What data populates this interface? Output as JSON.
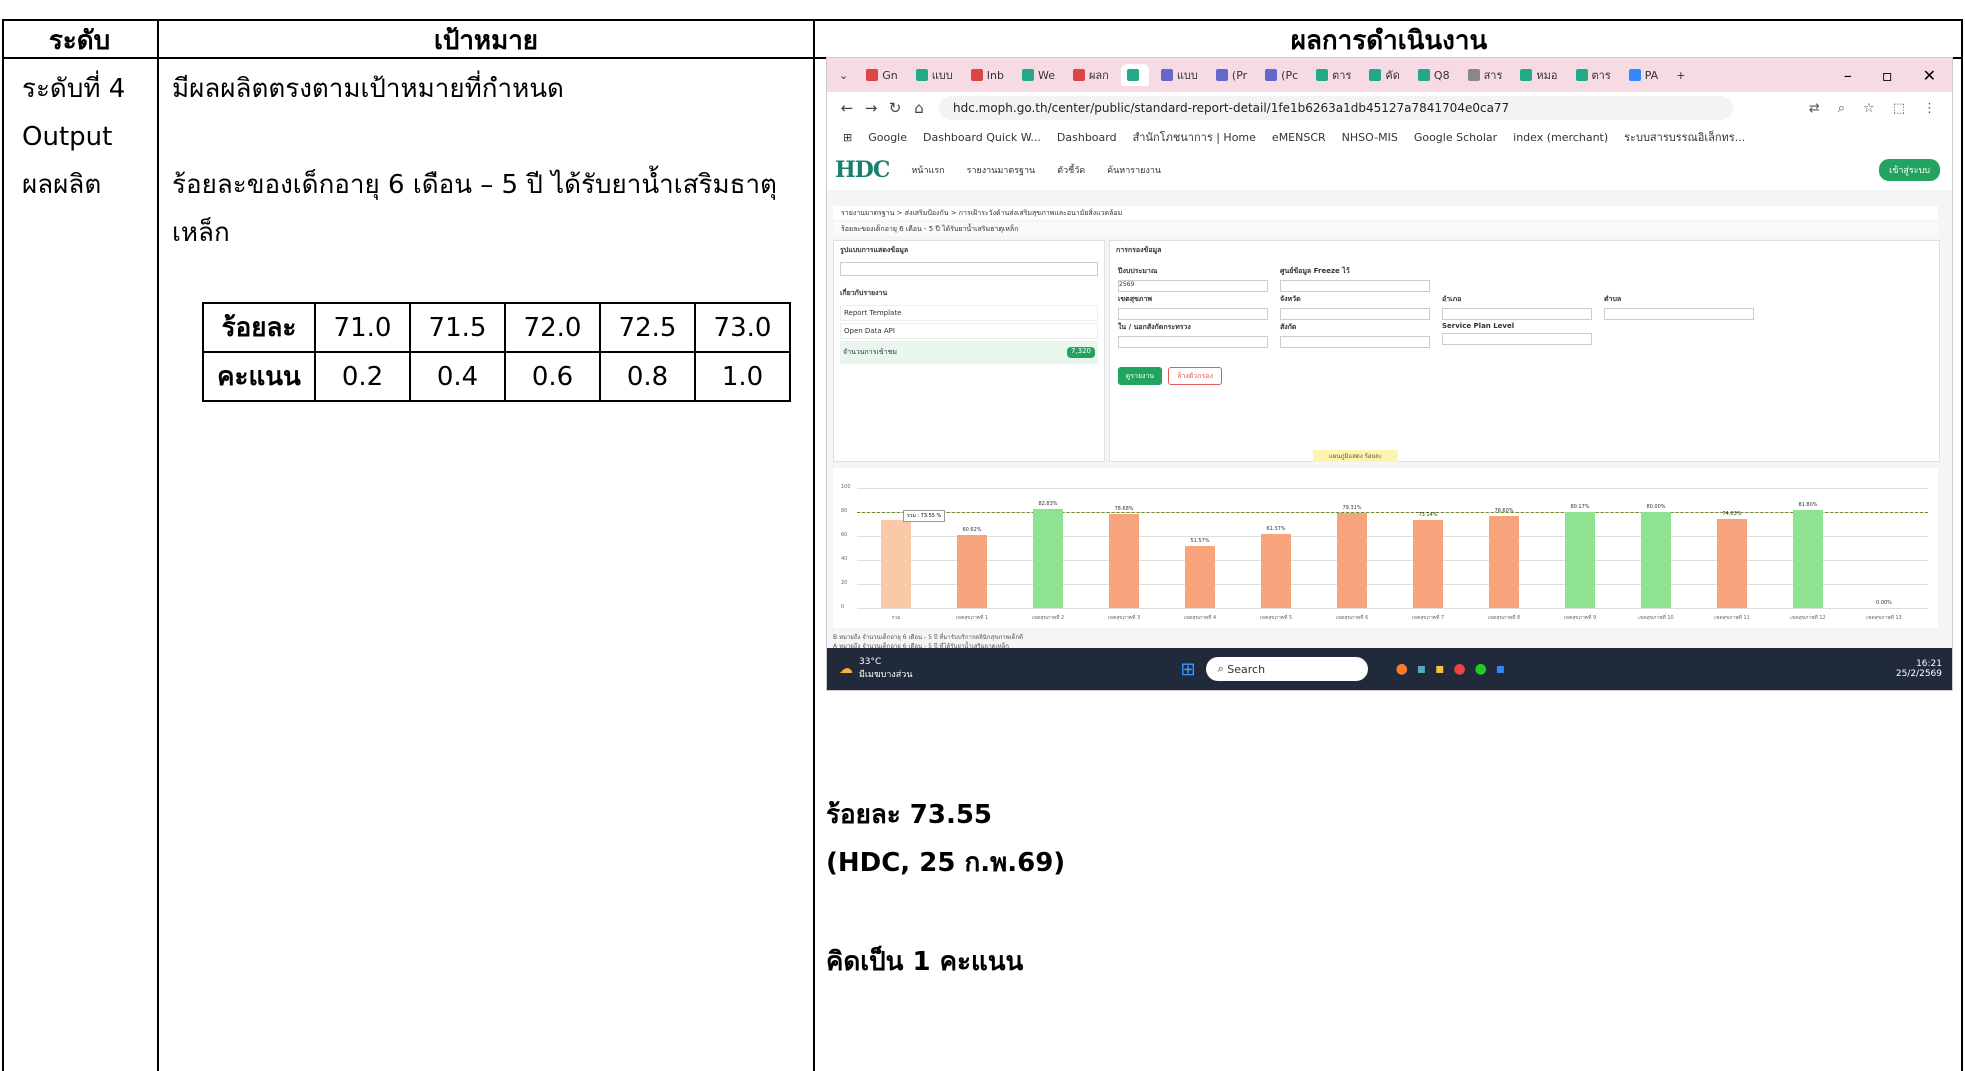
{
  "headers": {
    "level": "ระดับ",
    "goal": "เป้าหมาย",
    "result": "ผลการดำเนินงาน"
  },
  "level": {
    "line1": "ระดับที่ 4",
    "line2": "Output",
    "line3": "ผลผลิต"
  },
  "goal": {
    "line1": "มีผลผลิตตรงตามเป้าหมายที่กำหนด",
    "line2": "ร้อยละของเด็กอายุ 6 เดือน – 5 ปี ได้รับยาน้ำเสริมธาตุ",
    "line3": "เหล็ก"
  },
  "score_table": {
    "row1_label": "ร้อยละ",
    "row1_values": [
      "71.0",
      "71.5",
      "72.0",
      "72.5",
      "73.0"
    ],
    "row2_label": "คะแนน",
    "row2_values": [
      "0.2",
      "0.4",
      "0.6",
      "0.8",
      "1.0"
    ]
  },
  "browser": {
    "tabs": [
      "Gn",
      "แบบ",
      "Inb",
      "We",
      "ผลก",
      "",
      "แบบ",
      "(Pr",
      "(Pc",
      "ตาร",
      "คัด",
      "Q8",
      "สาร",
      "หมอ",
      "ตาร",
      "PA"
    ],
    "url": "hdc.moph.go.th/center/public/standard-report-detail/1fe1b6263a1db45127a7841704e0ca77",
    "bookmarks": [
      "Google",
      "Dashboard Quick W...",
      "Dashboard",
      "สำนักโภชนาการ | Home",
      "eMENSCR",
      "NHSO-MIS",
      "Google Scholar",
      "index (merchant)",
      "ระบบสารบรรณอิเล็กทร..."
    ],
    "site_logo": "HDC",
    "site_nav": [
      "หน้าแรก",
      "รายงานมาตรฐาน",
      "ตัวชี้วัด",
      "ค้นหารายงาน"
    ],
    "login": "เข้าสู่ระบบ",
    "breadcrumb": "รายงานมาตรฐาน > ส่งเสริมป้องกัน > การเฝ้าระวังด้านส่งเสริมสุขภาพและอนามัยสิ่งแวดล้อม",
    "report_title": "ร้อยละของเด็กอายุ 6 เดือน - 5 ปี ได้รับยาน้ำเสริมธาตุเหล็ก",
    "filter_title": "การกรองข้อมูล",
    "info_title": "รูปแบบการแสดงข้อมูล",
    "about_title": "เกี่ยวกับรายงาน",
    "about_items": [
      "Report Template",
      "Open Data API",
      "จำนวนการเข้าชม"
    ],
    "views": "7,320",
    "filters": [
      "ปีงบประมาณ",
      "ศูนย์ข้อมูล Freeze ไว้",
      "เขตสุขภาพ",
      "จังหวัด",
      "อำเภอ",
      "ตำบล",
      "ใน / นอกสังกัดกระทรวง",
      "สังกัด",
      "Service Plan Level"
    ],
    "fiscal_year": "2569",
    "btn_search": "ดูรายงาน",
    "btn_clear": "ล้างตัวกรอง",
    "chart_caption": "แผนภูมิแสดง ร้อยละ",
    "legend1": "B หมายถึง จำนวนเด็กอายุ 6 เดือน - 5 ปี ที่มารับบริการคลินิกสุขภาพเด็กดี",
    "legend2": "A หมายถึง จำนวนเด็กอายุ 6 เดือน - 5 ปี ที่ได้รับยาน้ำเสริมธาตุเหล็ก",
    "tooltip": "รวม : 73.55 %",
    "taskbar_temp": "33°C",
    "taskbar_weather": "มีเมฆบางส่วน",
    "taskbar_search": "Search",
    "clock_time": "16:21",
    "clock_date": "25/2/2569"
  },
  "chart_data": {
    "type": "bar",
    "categories": [
      "รวม",
      "เขตสุขภาพที่ 1",
      "เขตสุขภาพที่ 2",
      "เขตสุขภาพที่ 3",
      "เขตสุขภาพที่ 4",
      "เขตสุขภาพที่ 5",
      "เขตสุขภาพที่ 6",
      "เขตสุขภาพที่ 7",
      "เขตสุขภาพที่ 8",
      "เขตสุขภาพที่ 9",
      "เขตสุขภาพที่ 10",
      "เขตสุขภาพที่ 11",
      "เขตสุขภาพที่ 12",
      "เขตสุขภาพที่ 13"
    ],
    "values": [
      73.55,
      60.62,
      82.83,
      78.68,
      51.57,
      61.37,
      79.31,
      73.14,
      76.6,
      80.17,
      80.0,
      74.03,
      81.8,
      0.0
    ],
    "labels": [
      "",
      "60.62%",
      "82.83%",
      "78.68%",
      "51.57%",
      "61.37%",
      "79.31%",
      "73.14%",
      "76.60%",
      "80.17%",
      "80.00%",
      "74.03%",
      "81.80%",
      "0.00%"
    ],
    "colors": [
      "#f9c9a8",
      "#f7a47c",
      "#8fe28f",
      "#f7a47c",
      "#f7a47c",
      "#f7a47c",
      "#f7a47c",
      "#f7a47c",
      "#f7a47c",
      "#8fe28f",
      "#8fe28f",
      "#f7a47c",
      "#8fe28f",
      "#f7a47c"
    ],
    "yticks": [
      "0",
      "20",
      "40",
      "60",
      "80",
      "100"
    ],
    "ylim": [
      0,
      100
    ],
    "target": 80
  },
  "result": {
    "line1": "ร้อยละ 73.55",
    "line2": "(HDC, 25 ก.พ.69)",
    "line3": "คิดเป็น 1 คะแนน"
  }
}
